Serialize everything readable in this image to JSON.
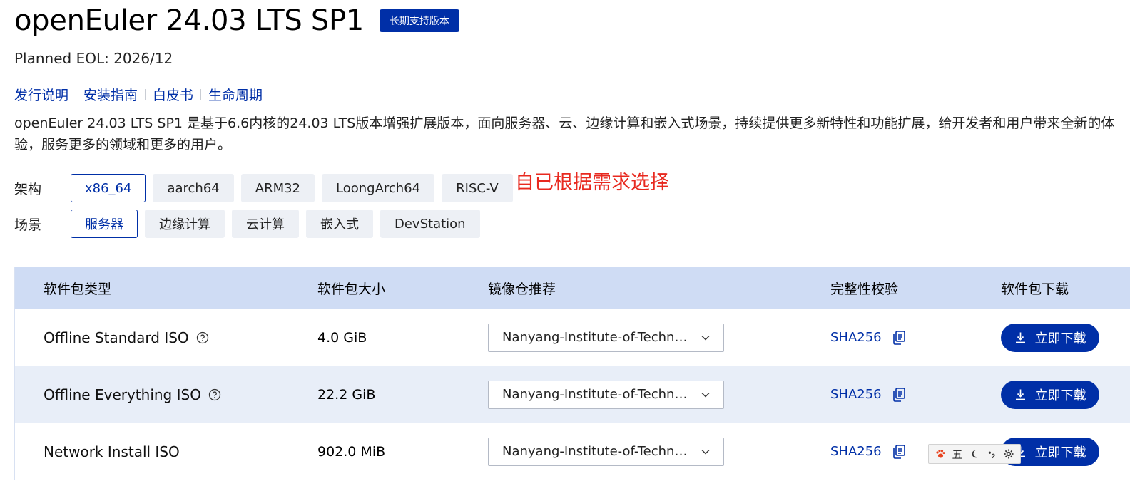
{
  "header": {
    "title": "openEuler 24.03 LTS SP1",
    "badge": "长期支持版本",
    "eol": "Planned EOL: 2026/12"
  },
  "links": [
    "发行说明",
    "安装指南",
    "白皮书",
    "生命周期"
  ],
  "description": {
    "line1": "openEuler 24.03 LTS SP1 是基于6.6内核的24.03 LTS版本增强扩展版本，面向服务器、云、边缘计算和嵌入式场景，持续提供更多新特性和功能扩展，给开发者和用户带来全新的体",
    "line2": "验，服务更多的领域和更多的用户。"
  },
  "filters": {
    "arch_label": "架构",
    "arch_options": [
      "x86_64",
      "aarch64",
      "ARM32",
      "LoongArch64",
      "RISC-V"
    ],
    "arch_selected": "x86_64",
    "scene_label": "场景",
    "scene_options": [
      "服务器",
      "边缘计算",
      "云计算",
      "嵌入式",
      "DevStation"
    ],
    "scene_selected": "服务器"
  },
  "annotation": "自已根据需求选择",
  "table": {
    "headers": [
      "软件包类型",
      "软件包大小",
      "镜像仓推荐",
      "完整性校验",
      "软件包下载"
    ],
    "rows": [
      {
        "name": "Offline Standard ISO",
        "size": "4.0 GiB",
        "mirror": "Nanyang-Institute-of-Technology",
        "checksum": "SHA256",
        "download": "立即下载"
      },
      {
        "name": "Offline Everything ISO",
        "size": "22.2 GiB",
        "mirror": "Nanyang-Institute-of-Technology",
        "checksum": "SHA256",
        "download": "立即下载"
      },
      {
        "name": "Network Install ISO",
        "size": "902.0 MiB",
        "mirror": "Nanyang-Institute-of-Technology",
        "checksum": "SHA256",
        "download": "立即下载"
      }
    ]
  },
  "ime_toolbar": {
    "mode_label": "五",
    "icons": [
      "paw-icon",
      "moon-icon",
      "punctuation-icon",
      "gear-icon"
    ]
  },
  "colors": {
    "brand": "#002fa7",
    "annotation": "#e8291f",
    "table_header_bg": "#cfdcf4",
    "row_alt_bg": "#e8eef8"
  }
}
